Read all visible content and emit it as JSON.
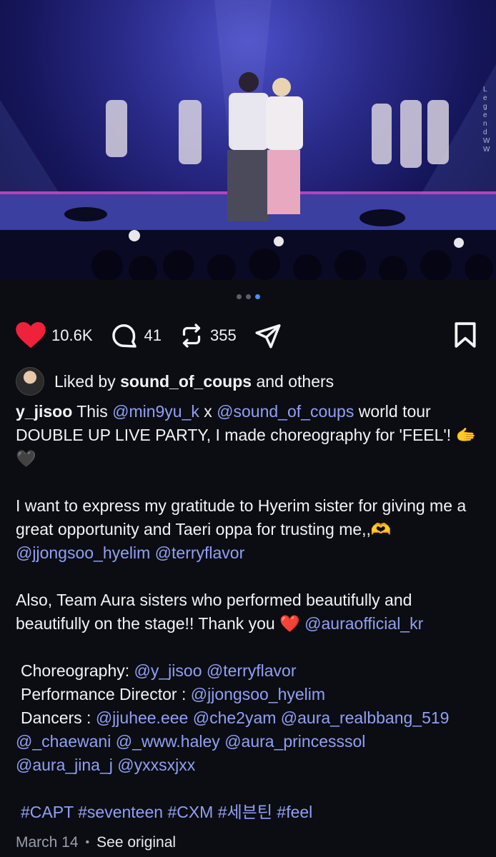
{
  "post": {
    "watermark": "LegendWW",
    "carousel": {
      "count": 3,
      "active_index": 2
    },
    "actions": {
      "likes": "10.6K",
      "comments": "41",
      "reposts": "355"
    },
    "liked_by": {
      "prefix": "Liked by",
      "user": "sound_of_coups",
      "suffix": "and others"
    },
    "caption": {
      "author": "y_jisoo",
      "p1_a": " This ",
      "m1": "@min9yu_k",
      "p1_b": " x ",
      "m2": "@sound_of_coups",
      "p1_c": " world tour DOUBLE UP LIVE PARTY, I made choreography for 'FEEL'! 🫱🖤",
      "p2_a": "I want to express my gratitude to Hyerim sister for giving me a great opportunity and Taeri oppa for trusting me,,🫶 ",
      "m3": "@jjongsoo_hyelim",
      "m4": "@terryflavor",
      "p3_a": "Also, Team Aura sisters who performed beautifully and beautifully on the stage!! Thank you ❤️ ",
      "m5": "@auraofficial_kr",
      "choreo_label": "Choreography: ",
      "m6": "@y_jisoo",
      "m7": "@terryflavor",
      "director_label": "Performance Director : ",
      "m8": "@jjongsoo_hyelim",
      "dancers_label": "Dancers : ",
      "d1": "@jjuhee.eee",
      "d2": "@che2yam",
      "d3": "@aura_realbbang_519",
      "d4": "@_chaewani",
      "d5": "@_www.haley",
      "d6": "@aura_princesssol",
      "d7": "@aura_jina_j",
      "d8": "@yxxsxjxx",
      "h1": "#CAPT",
      "h2": "#seventeen",
      "h3": "#CXM",
      "h4": "#세븐틴",
      "h5": "#feel"
    },
    "date": "March 14",
    "see_original": "See original"
  }
}
